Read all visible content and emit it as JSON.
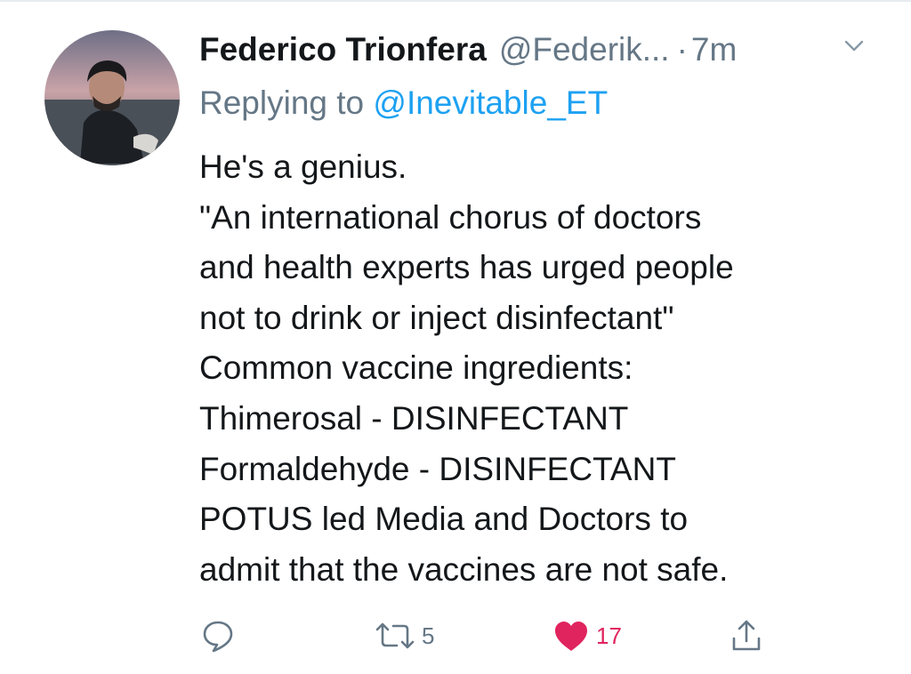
{
  "tweet": {
    "display_name": "Federico Trionfera",
    "handle": "@Federik...",
    "dot": "·",
    "time": "7m",
    "reply_prefix": "Replying to",
    "reply_mention": "@Inevitable_ET",
    "body_lines": [
      "He's a genius.",
      "\"An international chorus of doctors",
      "and health experts has urged people",
      "not to drink or inject disinfectant\"",
      "Common vaccine ingredients:",
      "Thimerosal - DISINFECTANT",
      "Formaldehyde - DISINFECTANT",
      "POTUS led Media and Doctors to",
      "admit that the vaccines are not safe."
    ]
  },
  "actions": {
    "reply_icon": "reply-bubble-icon",
    "retweet_icon": "retweet-icon",
    "retweet_count": "5",
    "like_icon": "heart-filled-icon",
    "like_count": "17",
    "share_icon": "share-icon"
  },
  "colors": {
    "text": "#14171a",
    "muted": "#657786",
    "link": "#1da1f2",
    "like": "#e0245e"
  }
}
